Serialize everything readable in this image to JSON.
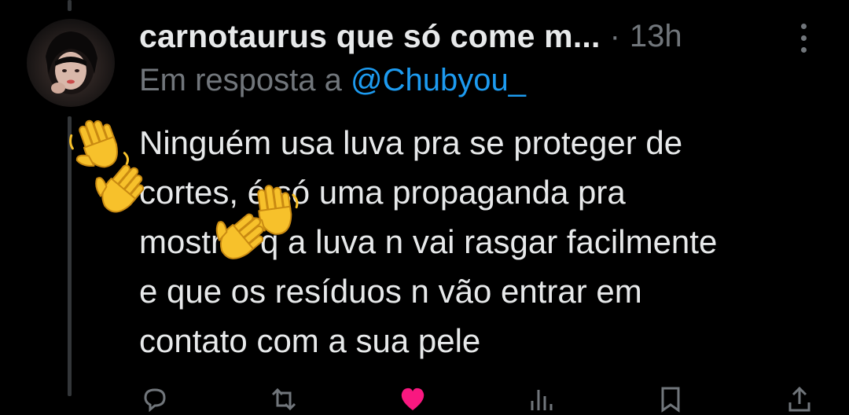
{
  "tweet": {
    "display_name": "carnotaurus que só come m...",
    "separator": "·",
    "time_ago": "13h",
    "reply_prefix": "Em resposta a",
    "reply_handle": "@Chubyou_",
    "text_lines": [
      "Ninguém usa luva pra se proteger de",
      "cortes, é só uma propaganda pra",
      "mostrar q a luva n vai rasgar facilmente",
      "e que os resíduos n vão entrar em",
      "contato com a sua pele"
    ]
  },
  "icons": {
    "avatar": "avatar",
    "more": "more-vertical-icon",
    "overlay": "waving-hand-emoji",
    "actions": [
      "reply-icon",
      "retweet-icon",
      "like-icon",
      "views-icon",
      "bookmark-icon",
      "share-icon"
    ]
  },
  "colors": {
    "background": "#000000",
    "text": "#e7e9ea",
    "secondary": "#71767b",
    "link": "#1d9bf0",
    "like": "#f91880",
    "thread_line": "#333639"
  }
}
